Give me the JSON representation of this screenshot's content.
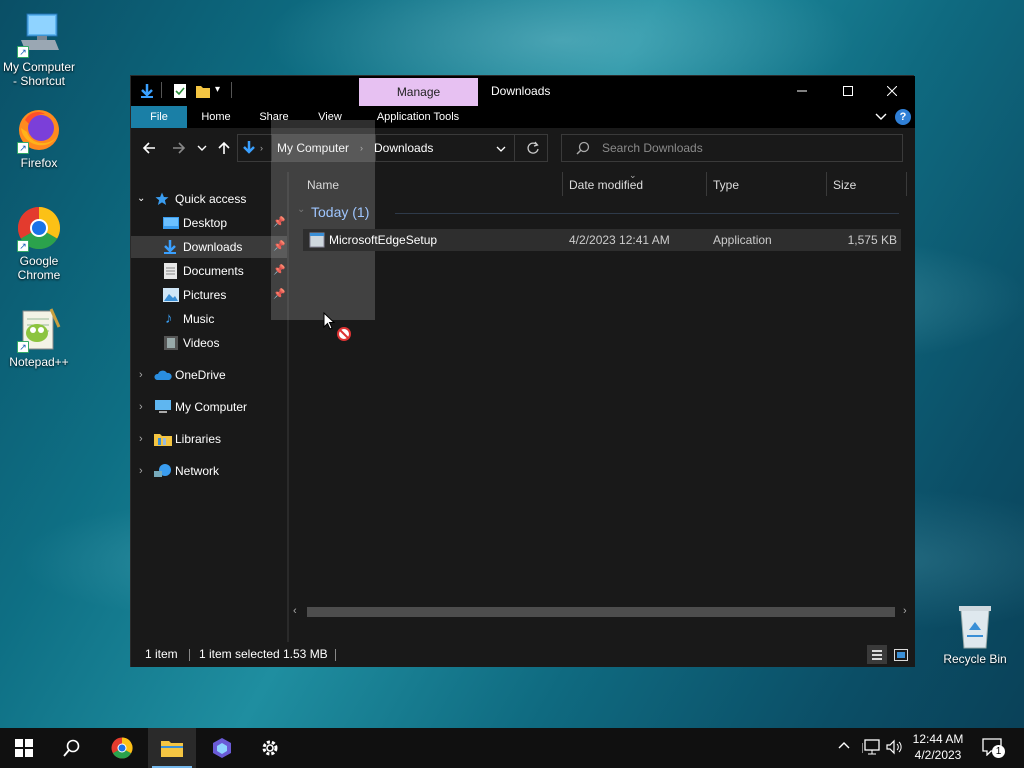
{
  "desktop": {
    "icons": [
      {
        "label": "My Computer - Shortcut",
        "icon": "computer-icon"
      },
      {
        "label": "Firefox",
        "icon": "firefox-icon"
      },
      {
        "label": "Google Chrome",
        "icon": "chrome-icon"
      },
      {
        "label": "Notepad++",
        "icon": "notepadpp-icon"
      },
      {
        "label": "Recycle Bin",
        "icon": "recycle-bin-icon"
      }
    ]
  },
  "window": {
    "title": "Downloads",
    "contextual_group": "Manage",
    "tabs": [
      "File",
      "Home",
      "Share",
      "View",
      "Application Tools"
    ],
    "address": {
      "segments": [
        "My Computer",
        "Downloads"
      ]
    },
    "search": {
      "placeholder": "Search Downloads"
    },
    "navigation": {
      "quick_access": "Quick access",
      "quick_items": [
        {
          "label": "Desktop",
          "icon": "desktop-folder-icon",
          "pinned": true
        },
        {
          "label": "Downloads",
          "icon": "downloads-folder-icon",
          "pinned": true,
          "selected": true
        },
        {
          "label": "Documents",
          "icon": "documents-folder-icon",
          "pinned": true
        },
        {
          "label": "Pictures",
          "icon": "pictures-folder-icon",
          "pinned": true
        },
        {
          "label": "Music",
          "icon": "music-folder-icon",
          "pinned": false
        },
        {
          "label": "Videos",
          "icon": "videos-folder-icon",
          "pinned": false
        }
      ],
      "roots": [
        {
          "label": "OneDrive",
          "icon": "onedrive-icon"
        },
        {
          "label": "My Computer",
          "icon": "computer-icon"
        },
        {
          "label": "Libraries",
          "icon": "libraries-icon"
        },
        {
          "label": "Network",
          "icon": "network-icon"
        }
      ]
    },
    "columns": [
      "Name",
      "Date modified",
      "Type",
      "Size"
    ],
    "group": "Today (1)",
    "files": [
      {
        "name": "MicrosoftEdgeSetup",
        "date": "4/2/2023 12:41 AM",
        "type": "Application",
        "size": "1,575 KB"
      }
    ],
    "status": {
      "items": "1 item",
      "selected": "1 item selected",
      "size": "1.53 MB"
    }
  },
  "taskbar": {
    "time": "12:44 AM",
    "date": "4/2/2023",
    "notification_count": "1"
  },
  "colors": {
    "accent": "#0078d4",
    "manage_tab": "#e0b3f0",
    "file_tab": "#1a7fa6"
  }
}
